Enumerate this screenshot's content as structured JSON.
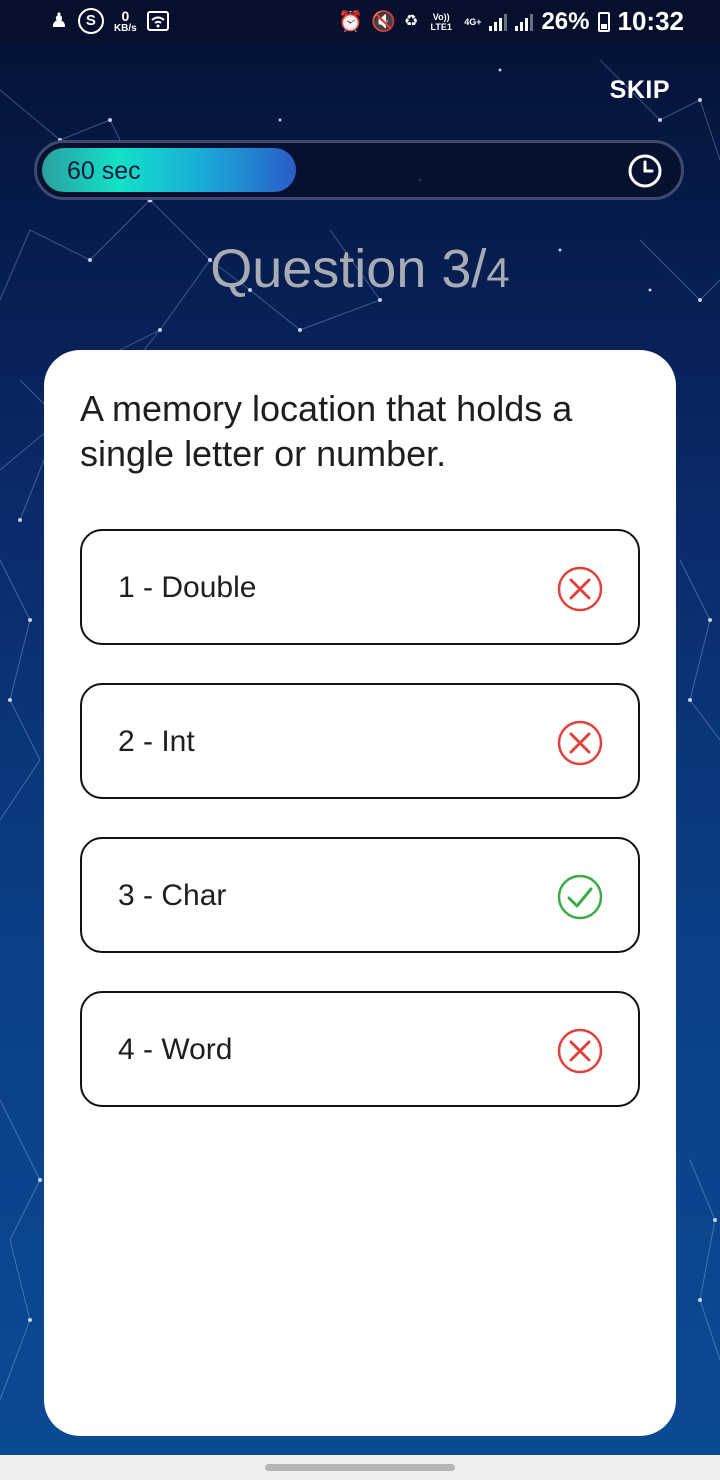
{
  "status_bar": {
    "net_speed_value": "0",
    "net_speed_unit": "KB/s",
    "volte_label": "Vo)) LTE1",
    "network_label": "4G+",
    "battery_percent": "26%",
    "time": "10:32"
  },
  "header": {
    "skip_label": "SKIP"
  },
  "timer": {
    "label": "60 sec",
    "progress_fraction": 0.4
  },
  "question_counter": {
    "prefix": "Question 3/",
    "total": "4"
  },
  "question": {
    "text": "A memory location that holds a single letter or number."
  },
  "options": [
    {
      "label": "1 - Double",
      "state": "wrong",
      "icon": "close-circle-icon"
    },
    {
      "label": "2 - Int",
      "state": "wrong",
      "icon": "close-circle-icon"
    },
    {
      "label": "3 - Char",
      "state": "correct",
      "icon": "check-circle-icon"
    },
    {
      "label": "4 - Word",
      "state": "wrong",
      "icon": "close-circle-icon"
    }
  ],
  "colors": {
    "wrong": "#e0423c",
    "correct": "#3cab48"
  }
}
